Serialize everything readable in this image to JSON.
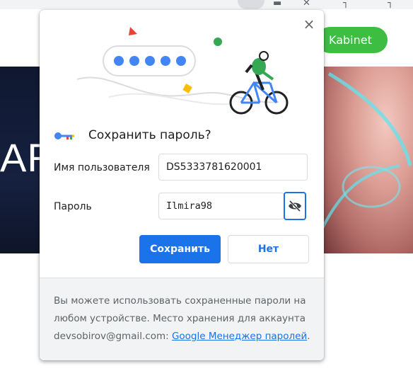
{
  "background": {
    "cabinet_button_label": "Kabinet",
    "hero_text": "AR"
  },
  "dialog": {
    "close_label": "×",
    "title": "Сохранить пароль?",
    "username": {
      "label": "Имя пользователя",
      "value": "DS5333781620001"
    },
    "password": {
      "label": "Пароль",
      "value": "Ilmira98"
    },
    "buttons": {
      "save": "Сохранить",
      "no": "Нет"
    },
    "footer": {
      "text_before": "Вы можете использовать сохраненные пароли на любом устройстве. Место хранения для аккаунта devsobirov@gmail.com: ",
      "link": "Google Менеджер паролей",
      "text_after": "."
    }
  },
  "colors": {
    "accent": "#1a73e8",
    "cabinet_green": "#3ebd43"
  },
  "icons": [
    "close-icon",
    "password-key-icon",
    "eye-off-icon"
  ]
}
